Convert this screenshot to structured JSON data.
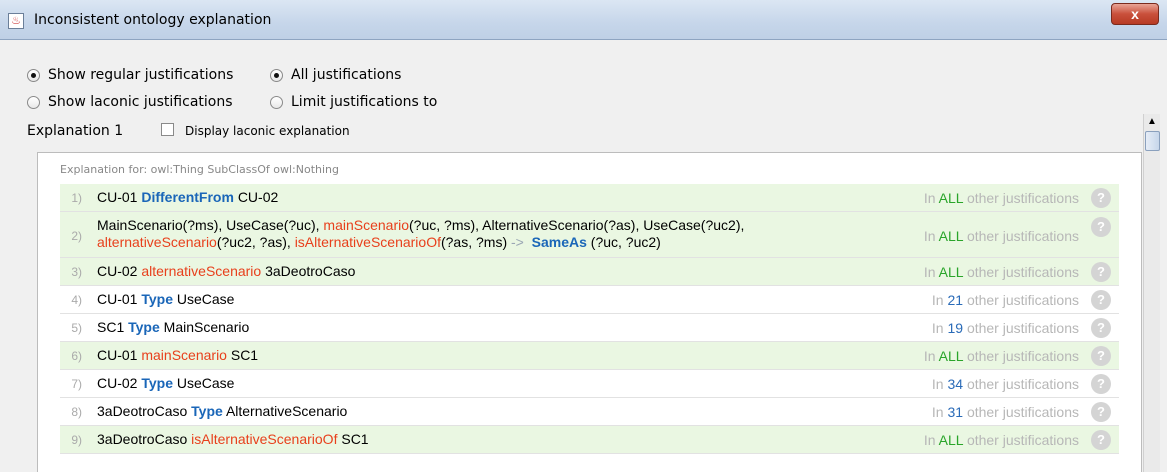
{
  "window": {
    "title": "Inconsistent ontology explanation",
    "close_label": "x"
  },
  "options": {
    "show_regular": "Show regular justifications",
    "show_laconic": "Show laconic justifications",
    "all_justifications": "All justifications",
    "limit_justifications": "Limit justifications to",
    "selected_view": "Show regular justifications",
    "selected_scope": "All justifications"
  },
  "explanation": {
    "label": "Explanation 1",
    "display_laconic_label": "Display laconic explanation",
    "display_laconic_checked": false,
    "header": "Explanation for: owl:Thing SubClassOf owl:Nothing"
  },
  "rows": [
    {
      "num": "1)",
      "prefix": "In",
      "count": "ALL",
      "suffix": "other justifications",
      "help": "?"
    },
    {
      "num": "2)",
      "prefix": "In",
      "count": "ALL",
      "suffix": "other justifications",
      "help": "?"
    },
    {
      "num": "3)",
      "prefix": "In",
      "count": "ALL",
      "suffix": "other justifications",
      "help": "?"
    },
    {
      "num": "4)",
      "prefix": "In",
      "count": "21",
      "suffix": "other justifications",
      "help": "?"
    },
    {
      "num": "5)",
      "prefix": "In",
      "count": "19",
      "suffix": "other justifications",
      "help": "?"
    },
    {
      "num": "6)",
      "prefix": "In",
      "count": "ALL",
      "suffix": "other justifications",
      "help": "?"
    },
    {
      "num": "7)",
      "prefix": "In",
      "count": "34",
      "suffix": "other justifications",
      "help": "?"
    },
    {
      "num": "8)",
      "prefix": "In",
      "count": "31",
      "suffix": "other justifications",
      "help": "?"
    },
    {
      "num": "9)",
      "prefix": "In",
      "count": "ALL",
      "suffix": "other justifications",
      "help": "?"
    }
  ],
  "axioms": {
    "r1": {
      "a": "CU-01",
      "kw": "DifferentFrom",
      "b": "CU-02"
    },
    "r2": {
      "t1": "MainScenario(?ms), UseCase(?uc), ",
      "p1": "mainScenario",
      "t2": "(?uc, ?ms), AlternativeScenario(?as), UseCase(?uc2),",
      "p2": "alternativeScenario",
      "t3": "(?uc2, ?as), ",
      "p3": "isAlternativeScenarioOf",
      "t4": "(?as, ?ms)",
      "arrow": "->",
      "kw": "SameAs",
      "t5": "(?uc, ?uc2)"
    },
    "r3": {
      "a": "CU-02",
      "kw": "alternativeScenario",
      "b": "3aDeotroCaso"
    },
    "r4": {
      "a": "CU-01",
      "kw": "Type",
      "b": "UseCase"
    },
    "r5": {
      "a": "SC1",
      "kw": "Type",
      "b": "MainScenario"
    },
    "r6": {
      "a": "CU-01",
      "kw": "mainScenario",
      "b": "SC1"
    },
    "r7": {
      "a": "CU-02",
      "kw": "Type",
      "b": "UseCase"
    },
    "r8": {
      "a": "3aDeotroCaso",
      "kw": "Type",
      "b": "AlternativeScenario"
    },
    "r9": {
      "a": "3aDeotroCaso",
      "kw": "isAlternativeScenarioOf",
      "b": "SC1"
    }
  },
  "colors": {
    "keyword": "#1a66b8",
    "property": "#e8401c",
    "all": "#2aa52a",
    "count": "#2a6bb8",
    "row_highlight": "#eaf7e2"
  }
}
